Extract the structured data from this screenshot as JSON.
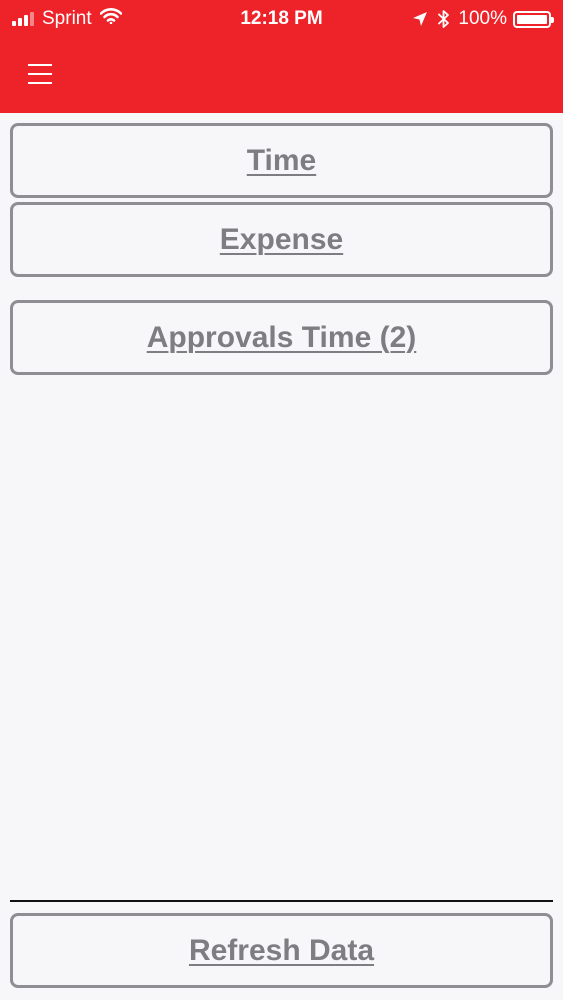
{
  "status_bar": {
    "carrier": "Sprint",
    "time": "12:18 PM",
    "battery": "100%"
  },
  "header": {
    "menu_icon": "hamburger-menu-icon",
    "background_color": "#ee2229"
  },
  "menu": {
    "items": [
      {
        "label": "Time"
      },
      {
        "label": "Expense"
      },
      {
        "label": "Approvals Time (2)"
      }
    ]
  },
  "footer": {
    "refresh_label": "Refresh Data"
  }
}
